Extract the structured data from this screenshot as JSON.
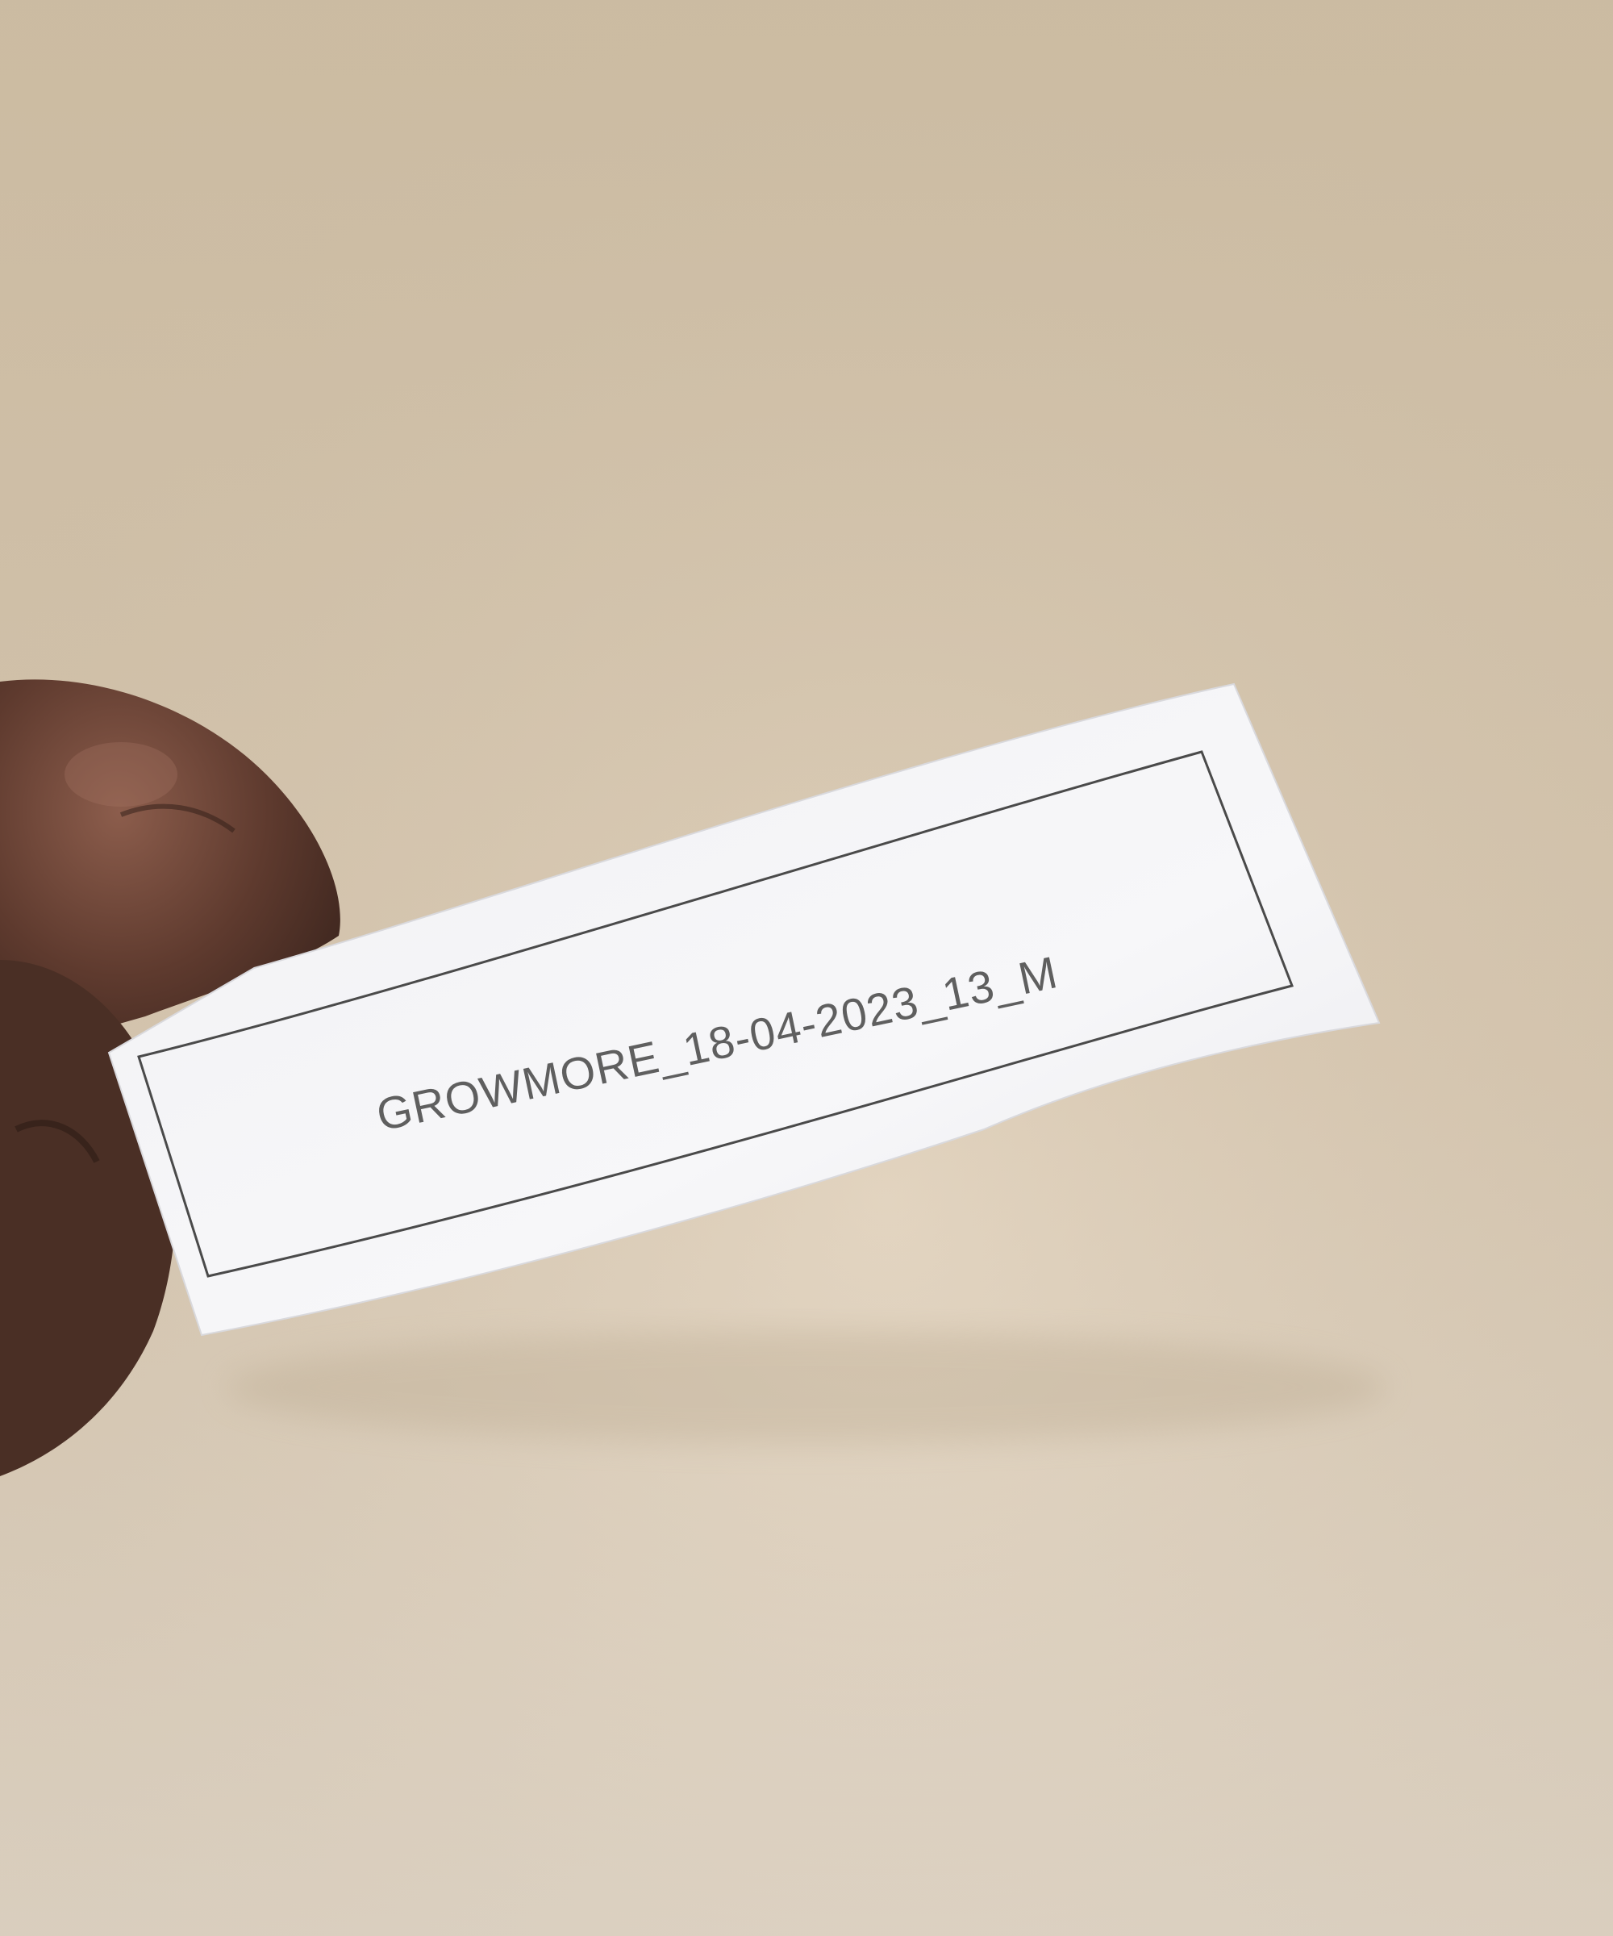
{
  "photo": {
    "subject": "hand-holding-paper-label",
    "label_text": "GROWMORE_18-04-2023_13_M",
    "colors": {
      "background_top": "#d8c7ad",
      "background_bottom": "#e3d6c3",
      "paper": "#f4f4f6",
      "border": "#4a4a4a",
      "text": "#5f5f5f",
      "skin_dark": "#3f2922",
      "skin_mid": "#6b4536",
      "skin_light": "#8c5d4c"
    }
  }
}
